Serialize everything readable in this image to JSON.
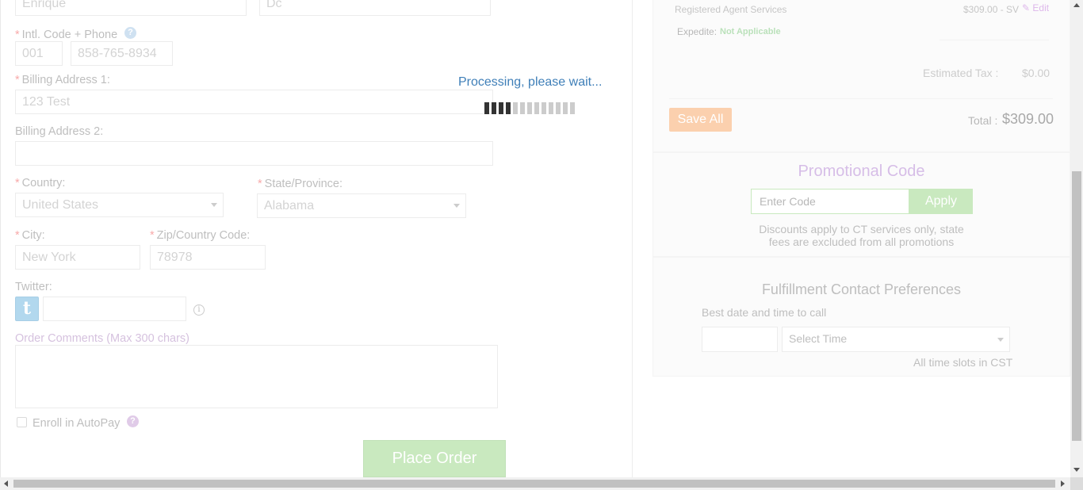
{
  "form": {
    "first_name_value": "Enrique",
    "last_name_value": "Dc",
    "phone_label": "Intl. Code + Phone",
    "intl_code_value": "001",
    "phone_value": "858-765-8934",
    "billing1_label": "Billing Address 1:",
    "billing1_value": "123 Test",
    "billing2_label": "Billing Address 2:",
    "billing2_value": "",
    "country_label": "Country:",
    "country_value": "United States",
    "state_label": "State/Province:",
    "state_value": "Alabama",
    "city_label": "City:",
    "city_value": "New York",
    "zip_label": "Zip/Country Code:",
    "zip_value": "78978",
    "twitter_label": "Twitter:",
    "twitter_icon_letter": "t",
    "twitter_value": "",
    "comments_label": "Order Comments (Max 300 chars)",
    "autopay_label": "Enroll in AutoPay",
    "help_glyph": "?",
    "info_glyph": "i",
    "place_order": "Place Order"
  },
  "processing": {
    "message": "Processing, please wait...",
    "progress_filled": 4,
    "progress_total": 13
  },
  "summary": {
    "service_name": "Registered Agent Services",
    "service_price": "$309.00 - SV",
    "edit_label": "Edit",
    "expedite_label": "Expedite:",
    "expedite_value": "Not Applicable",
    "tax_label": "Estimated Tax :",
    "tax_value": "$0.00",
    "save_all": "Save All",
    "total_label": "Total :",
    "total_value": "$309.00"
  },
  "promo": {
    "title": "Promotional Code",
    "placeholder": "Enter Code",
    "apply": "Apply",
    "note_line1": "Discounts apply to CT services only, state",
    "note_line2": "fees are excluded from all promotions"
  },
  "fulfillment": {
    "title": "Fulfillment Contact Preferences",
    "best_time_label": "Best date and time to call",
    "date_value": "",
    "time_value": "Select Time",
    "timezone_note": "All time slots in CST"
  },
  "colors": {
    "accent_orange": "#f6913f",
    "accent_green": "#7fcb68",
    "processing_blue": "#3f7fb8",
    "purple": "#a064c8"
  }
}
